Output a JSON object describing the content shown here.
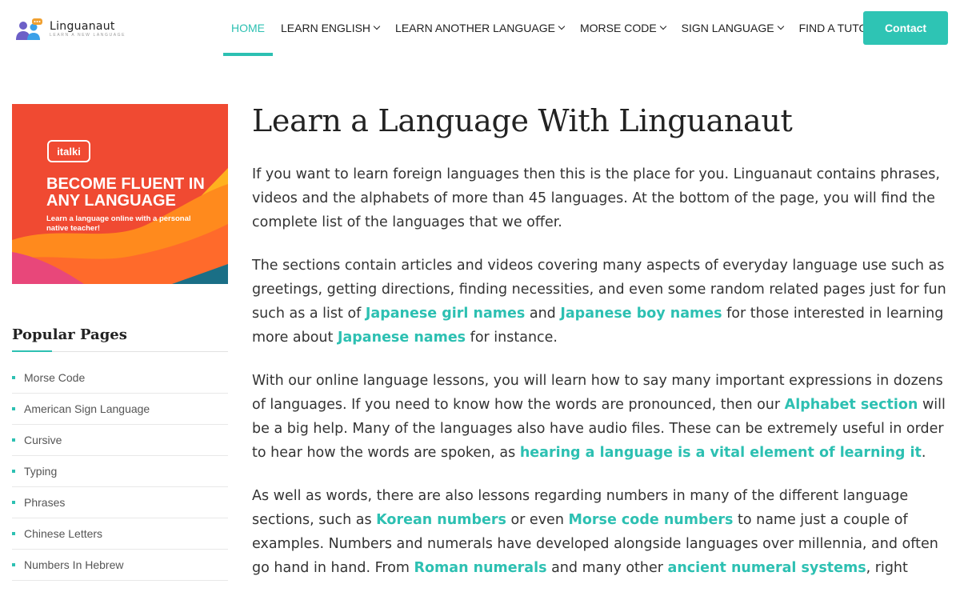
{
  "header": {
    "logo_name": "Linguanaut",
    "logo_tagline": "LEARN A NEW LANGUAGE",
    "nav": [
      {
        "label": "HOME",
        "active": true,
        "dropdown": false
      },
      {
        "label": "LEARN ENGLISH",
        "active": false,
        "dropdown": true
      },
      {
        "label": "LEARN ANOTHER LANGUAGE",
        "active": false,
        "dropdown": true
      },
      {
        "label": "MORSE CODE",
        "active": false,
        "dropdown": true
      },
      {
        "label": "SIGN LANGUAGE",
        "active": false,
        "dropdown": true
      },
      {
        "label": "FIND A TUTOR",
        "active": false,
        "dropdown": false
      }
    ],
    "contact_label": "Contact"
  },
  "sidebar": {
    "ad": {
      "brand": "italki",
      "headline": "BECOME FLUENT IN ANY LANGUAGE",
      "subtext": "Learn a language online with a personal native teacher!"
    },
    "popular_title": "Popular Pages",
    "popular_pages": [
      "Morse Code",
      "American Sign Language",
      "Cursive",
      "Typing",
      "Phrases",
      "Chinese Letters",
      "Numbers In Hebrew"
    ]
  },
  "main": {
    "title": "Learn a Language With Linguanaut",
    "p1": "If you want to learn foreign languages then this is the place for you. Linguanaut contains phrases, videos and the alphabets of more than 45 languages. At the bottom of the page, you will find the complete list of the languages that we offer.",
    "p2": {
      "t1": "The sections contain articles and videos covering many aspects of everyday language use such as greetings, getting directions, finding necessities, and even some random related pages just for fun such as a list of ",
      "l1": "Japanese girl names",
      "t2": " and ",
      "l2": "Japanese boy names",
      "t3": " for those interested in learning more about ",
      "l3": "Japanese names",
      "t4": " for instance."
    },
    "p3": {
      "t1": "With our online language lessons, you will learn how to say many important expressions in dozens of languages. If you need to know how the words are pronounced, then our ",
      "l1": "Alphabet section",
      "t2": " will be a big help. Many of the languages also have audio files. These can be extremely useful in order to hear how the words are spoken, as ",
      "l2": "hearing a language is a vital element of learning it",
      "t3": "."
    },
    "p4": {
      "t1": "As well as words, there are also lessons regarding numbers in many of the different language sections, such as ",
      "l1": "Korean numbers",
      "t2": " or even ",
      "l2": "Morse code numbers",
      "t3": " to name just a couple of examples. Numbers and numerals have developed alongside languages over millennia, and often go hand in hand. From ",
      "l3": "Roman numerals",
      "t4": " and many other ",
      "l4": "ancient numeral systems",
      "t5": ", right"
    }
  },
  "colors": {
    "accent": "#2dc0b2",
    "ad_red": "#f04a32",
    "ad_orange": "#ff8a1d",
    "ad_pink": "#e8477a",
    "ad_teal": "#1a6f86"
  }
}
